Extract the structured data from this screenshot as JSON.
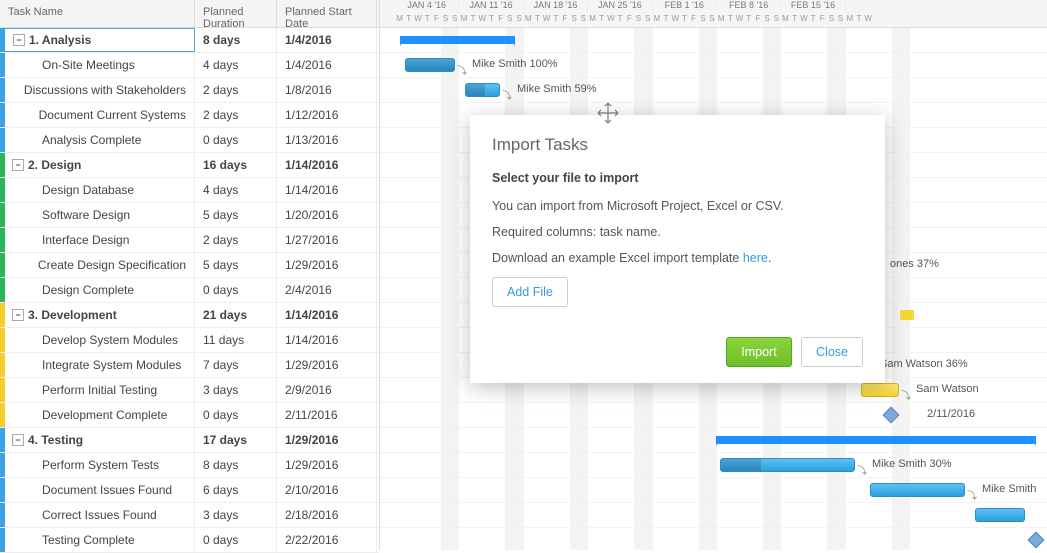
{
  "headers": {
    "name": "Task Name",
    "duration": "Planned Duration",
    "start": "Planned Start Date"
  },
  "weeks": [
    "JAN 4 '16",
    "JAN 11 '16",
    "JAN 18 '16",
    "JAN 25 '16",
    "FEB 1 '16",
    "FEB 8 '16",
    "FEB 15 '16"
  ],
  "dayPattern": [
    "M",
    "T",
    "W",
    "T",
    "F",
    "S",
    "S"
  ],
  "rows": [
    {
      "id": "1",
      "parent": true,
      "selected": true,
      "label": "1. Analysis",
      "dur": "8 days",
      "start": "1/4/2016",
      "color": "#3aa3e3",
      "barType": "summary",
      "barLeft": 20,
      "barWidth": 115
    },
    {
      "id": "1.1",
      "label": "On-Site Meetings",
      "dur": "4 days",
      "start": "1/4/2016",
      "color": "#3aa3e3",
      "barType": "task",
      "barLeft": 25,
      "barWidth": 50,
      "progress": 100,
      "assignee": "Mike Smith",
      "pct": "100%"
    },
    {
      "id": "1.2",
      "label": "Discussions with Stakeholders",
      "dur": "2 days",
      "start": "1/8/2016",
      "color": "#3aa3e3",
      "barType": "task",
      "barLeft": 85,
      "barWidth": 35,
      "progress": 59,
      "assignee": "Mike Smith",
      "pct": "59%"
    },
    {
      "id": "1.3",
      "label": "Document Current Systems",
      "dur": "2 days",
      "start": "1/12/2016",
      "color": "#3aa3e3"
    },
    {
      "id": "1.4",
      "label": "Analysis Complete",
      "dur": "0 days",
      "start": "1/13/2016",
      "color": "#3aa3e3"
    },
    {
      "id": "2",
      "parent": true,
      "label": "2. Design",
      "dur": "16 days",
      "start": "1/14/2016",
      "color": "#2ab55a"
    },
    {
      "id": "2.1",
      "label": "Design Database",
      "dur": "4 days",
      "start": "1/14/2016",
      "color": "#2ab55a"
    },
    {
      "id": "2.2",
      "label": "Software Design",
      "dur": "5 days",
      "start": "1/20/2016",
      "color": "#2ab55a"
    },
    {
      "id": "2.3",
      "label": "Interface Design",
      "dur": "2 days",
      "start": "1/27/2016",
      "color": "#2ab55a"
    },
    {
      "id": "2.4",
      "label": "Create Design Specification",
      "dur": "5 days",
      "start": "1/29/2016",
      "color": "#2ab55a",
      "extraLabel": "ones  37%",
      "extraLeft": 510
    },
    {
      "id": "2.5",
      "label": "Design Complete",
      "dur": "0 days",
      "start": "2/4/2016",
      "color": "#2ab55a"
    },
    {
      "id": "3",
      "parent": true,
      "label": "3. Development",
      "dur": "21 days",
      "start": "1/14/2016",
      "color": "#f3cd29",
      "extraMark": true,
      "extraLeft": 520
    },
    {
      "id": "3.1",
      "label": "Develop System Modules",
      "dur": "11 days",
      "start": "1/14/2016",
      "color": "#f3cd29"
    },
    {
      "id": "3.2",
      "label": "Integrate System Modules",
      "dur": "7 days",
      "start": "1/29/2016",
      "color": "#f3cd29",
      "extraLabel": "Sam Watson  36%",
      "extraLeft": 500
    },
    {
      "id": "3.3",
      "label": "Perform Initial Testing",
      "dur": "3 days",
      "start": "2/9/2016",
      "color": "#f3cd29",
      "barType": "task",
      "barClass": "yellow",
      "barLeft": 481,
      "barWidth": 38,
      "assignee": "Sam Watson",
      "pct": ""
    },
    {
      "id": "3.4",
      "label": "Development Complete",
      "dur": "0 days",
      "start": "2/11/2016",
      "color": "#f3cd29",
      "barType": "milestone",
      "barLeft": 505,
      "assignee": "2/11/2016"
    },
    {
      "id": "4",
      "parent": true,
      "label": "4. Testing",
      "dur": "17 days",
      "start": "1/29/2016",
      "color": "#3aa3e3",
      "barType": "summary",
      "barLeft": 336,
      "barWidth": 320
    },
    {
      "id": "4.1",
      "label": "Perform System Tests",
      "dur": "8 days",
      "start": "1/29/2016",
      "color": "#3aa3e3",
      "barType": "task",
      "barLeft": 340,
      "barWidth": 135,
      "progress": 30,
      "assignee": "Mike Smith",
      "pct": "30%"
    },
    {
      "id": "4.2",
      "label": "Document Issues Found",
      "dur": "6 days",
      "start": "2/10/2016",
      "color": "#3aa3e3",
      "barType": "task",
      "barLeft": 490,
      "barWidth": 95,
      "assignee": "Mike Smith",
      "pct": ""
    },
    {
      "id": "4.3",
      "label": "Correct Issues Found",
      "dur": "3 days",
      "start": "2/18/2016",
      "color": "#3aa3e3",
      "barType": "task",
      "barLeft": 595,
      "barWidth": 50
    },
    {
      "id": "4.4",
      "label": "Testing Complete",
      "dur": "0 days",
      "start": "2/22/2016",
      "color": "#3aa3e3",
      "barType": "milestone",
      "barLeft": 650
    }
  ],
  "dialog": {
    "title": "Import Tasks",
    "subtitle": "Select your file to import",
    "line1": "You can import from Microsoft Project, Excel or CSV.",
    "line2": "Required columns: task name.",
    "line3a": "Download an example Excel import template ",
    "line3link": "here",
    "line3b": ".",
    "addFile": "Add File",
    "import": "Import",
    "close": "Close"
  }
}
